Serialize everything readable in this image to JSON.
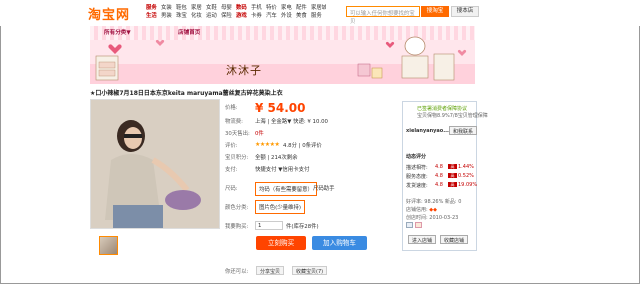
{
  "header": {
    "logo": "淘宝网",
    "nav_rows": [
      [
        "服务",
        "女装",
        "鞋包",
        "家居",
        "女鞋",
        "母婴",
        "数码",
        "手机",
        "特价",
        "家电",
        "配件",
        "家居城"
      ],
      [
        "生活",
        "男装",
        "珠宝",
        "化妆",
        "运动",
        "保险",
        "游戏",
        "卡券",
        "汽车",
        "外设",
        "美食",
        "服务"
      ]
    ],
    "search_placeholder": "可以输入任何你想要找的宝贝",
    "search_button": "搜淘宝",
    "local_button": "搜本店"
  },
  "banner": {
    "category_nav": "所有分类▼",
    "home_nav": "店铺首页",
    "shop_name": "沐沐子"
  },
  "product": {
    "title": "★口小辣椒7月18日日本东京keita maruyama蕾丝复古碎花莫染上衣",
    "price_label": "价格:",
    "price": "¥ 54.00",
    "shipping_label": "物流费:",
    "shipping_value": "上海 | 全金路▼   快递:  ¥  10.00",
    "sales_label": "30天售出:",
    "sales_value": "0件",
    "rating_label": "评价:",
    "stars": "★★★★★",
    "rating_value": "4.8分  |  0条评价",
    "points_label": "宝贝积分:",
    "points_value": "全额  |  214次剩余",
    "payment_label": "支付:",
    "payment_value": "快捷支付  ▼信用卡支付",
    "size_label": "尺码:",
    "size_option": "均码（有些需要留意）",
    "size_help": "尺码助手",
    "color_label": "颜色分类:",
    "color_option": "图片色(少量维持)",
    "qty_label": "我要购买:",
    "qty_value": "1",
    "qty_stock": "件(库存28件)",
    "buy_button": "立刻购买",
    "cart_button": "加入购物车",
    "share_label": "你还可以:",
    "share_button": "分享宝贝",
    "fav_button": "收藏宝贝(7)"
  },
  "seller": {
    "guarantee_line1": "已签署消费者保障协议",
    "guarantee_line2": "宝贝保物8.9%7/8宝贝管理保障",
    "seller_name": "xielanyanyao...",
    "contact_button": "和我联系",
    "rating_title": "动态评分",
    "rating_rows": [
      {
        "label": "描述相符:",
        "score": "4.8",
        "change": "1.44%"
      },
      {
        "label": "服务态度:",
        "score": "4.8",
        "change": "0.52%"
      },
      {
        "label": "发货速度:",
        "score": "4.8",
        "change": "19.09%"
      }
    ],
    "good_rate": "好评率: 98.26% 新品: 0",
    "credit": "店铺信用: ",
    "since": "创店时间: 2010-03-23",
    "enter_shop": "进入店铺",
    "fav_shop": "收藏店铺"
  },
  "colors": {
    "accent": "#ff6a00",
    "buy": "#ff4400",
    "cart": "#3a8be2",
    "banner": "#ffe6ec"
  }
}
